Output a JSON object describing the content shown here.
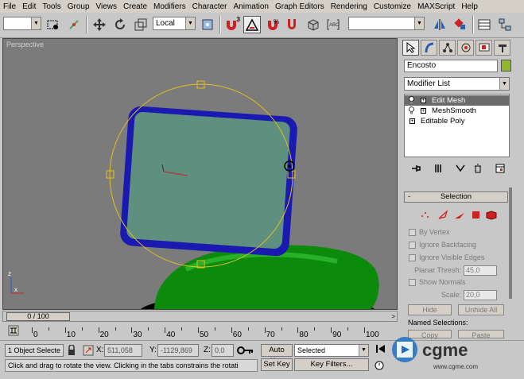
{
  "menu": [
    "File",
    "Edit",
    "Tools",
    "Group",
    "Views",
    "Create",
    "Modifiers",
    "Character",
    "Animation",
    "Graph Editors",
    "Rendering",
    "Customize",
    "MAXScript",
    "Help"
  ],
  "toolbar": {
    "selection_filter": "",
    "coord_system": "Local",
    "named_selection": "",
    "snap_label": "3"
  },
  "viewport": {
    "label": "Perspective"
  },
  "panel": {
    "object_name": "Encosto",
    "object_color": "#8fb62c",
    "modifier_list": "Modifier List",
    "stack": [
      {
        "name": "Edit Mesh",
        "selected": true
      },
      {
        "name": "MeshSmooth",
        "selected": false
      },
      {
        "name": "Editable Poly",
        "selected": false
      }
    ],
    "rollout": {
      "title": "Selection",
      "minus": "-",
      "by_vertex": "By Vertex",
      "ignore_backfacing": "Ignore Backfacing",
      "ignore_visible_edges": "Ignore Visible Edges",
      "planar_thresh_label": "Planar Thresh:",
      "planar_thresh_value": "45,0",
      "show_normals": "Show Normals",
      "scale_label": "Scale:",
      "scale_value": "20,0",
      "hide": "Hide",
      "unhide_all": "Unhide All",
      "named_selections": "Named Selections:",
      "copy": "Copy",
      "paste": "Paste"
    }
  },
  "time": {
    "slider_label": "0 / 100",
    "ticks": [
      "0",
      "10",
      "20",
      "30",
      "40",
      "50",
      "60",
      "70",
      "80",
      "90",
      "100"
    ]
  },
  "status": {
    "selected_count": "1 Object Selecte",
    "x_label": "X:",
    "x_value": "511,058",
    "y_label": "Y:",
    "y_value": "-1129,869",
    "z_label": "Z:",
    "z_value": "0,0",
    "auto_key": "Auto Key",
    "set_key": "Set Key",
    "key_mode": "Selected",
    "key_filters": "Key Filters...",
    "prompt": "Click and drag to rotate the view.  Clicking in the tabs constrains the rotati"
  },
  "watermark": {
    "brand": "cgme",
    "url": "www.cgme.com"
  }
}
